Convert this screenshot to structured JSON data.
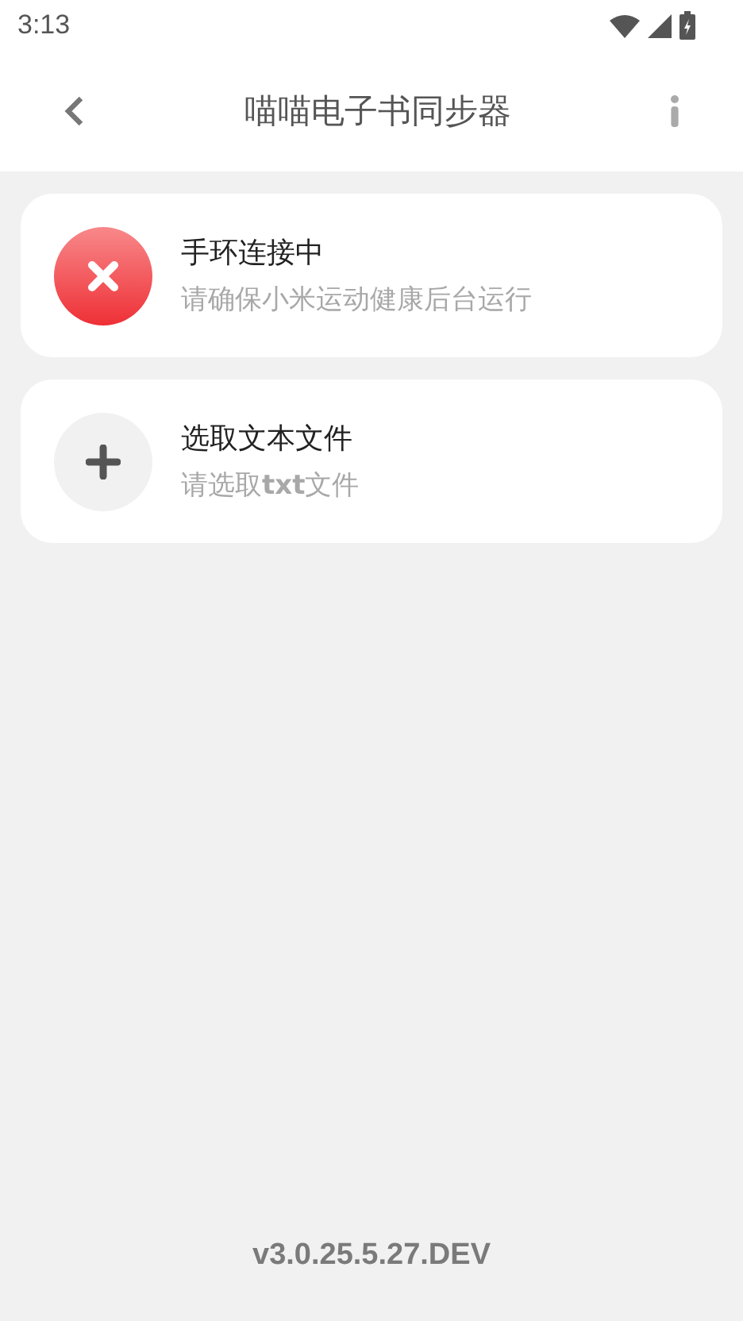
{
  "status_bar": {
    "time": "3:13"
  },
  "header": {
    "title": "喵喵电子书同步器"
  },
  "cards": [
    {
      "kind": "error",
      "title": "手环连接中",
      "subtitle": "请确保小米运动健康后台运行"
    },
    {
      "kind": "add",
      "title": "选取文本文件",
      "subtitle": "请选取**txt**文件"
    }
  ],
  "version": "v3.0.25.5.27.DEV"
}
